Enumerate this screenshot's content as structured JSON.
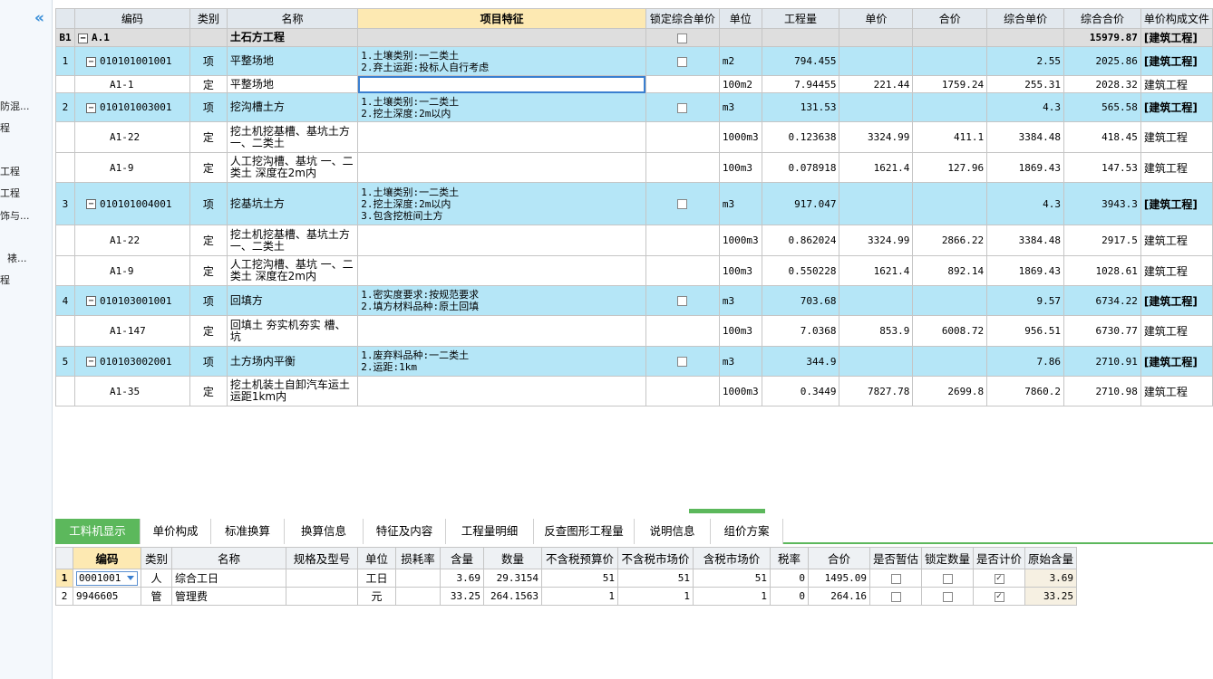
{
  "left_panel": {
    "collapse_icon": "double-chevron-left-icon",
    "items": [
      "防混...",
      "程",
      "工程",
      "工程",
      "饰与...",
      "裱...",
      "程"
    ]
  },
  "top_grid": {
    "headers": [
      "",
      "编码",
      "类别",
      "名称",
      "项目特征",
      "锁定综合单价",
      "单位",
      "工程量",
      "单价",
      "合价",
      "综合单价",
      "综合合价",
      "单价构成文件"
    ],
    "rows": [
      {
        "type": "b1",
        "seq": "B1",
        "code": "A.1",
        "cat": "",
        "name": "土石方工程",
        "feature": "",
        "lock": true,
        "unit": "",
        "qty": "",
        "price": "",
        "total": "",
        "comp_price": "",
        "comp_total": "15979.87",
        "file": "[建筑工程]"
      },
      {
        "type": "xiang",
        "seq": "1",
        "code": "010101001001",
        "cat": "项",
        "name": "平整场地",
        "feature": "1.土壤类别:一二类土\n2.弃土运距:投标人自行考虑",
        "lock": true,
        "unit": "m2",
        "qty": "794.455",
        "price": "",
        "total": "",
        "comp_price": "2.55",
        "comp_total": "2025.86",
        "file": "[建筑工程]"
      },
      {
        "type": "ding",
        "seq": "",
        "code": "A1-1",
        "cat": "定",
        "name": "平整场地",
        "feature": "",
        "lock": false,
        "unit": "100m2",
        "qty": "7.94455",
        "price": "221.44",
        "total": "1759.24",
        "comp_price": "255.31",
        "comp_total": "2028.32",
        "file": "建筑工程"
      },
      {
        "type": "xiang",
        "seq": "2",
        "code": "010101003001",
        "cat": "项",
        "name": "挖沟槽土方",
        "feature": "1.土壤类别:一二类土\n2.挖土深度:2m以内",
        "lock": true,
        "unit": "m3",
        "qty": "131.53",
        "price": "",
        "total": "",
        "comp_price": "4.3",
        "comp_total": "565.58",
        "file": "[建筑工程]"
      },
      {
        "type": "ding",
        "seq": "",
        "code": "A1-22",
        "cat": "定",
        "name": "挖土机挖基槽、基坑土方 一、二类土",
        "feature": "",
        "lock": false,
        "unit": "1000m3",
        "qty": "0.123638",
        "price": "3324.99",
        "total": "411.1",
        "comp_price": "3384.48",
        "comp_total": "418.45",
        "file": "建筑工程"
      },
      {
        "type": "ding",
        "seq": "",
        "code": "A1-9",
        "cat": "定",
        "name": "人工挖沟槽、基坑 一、二类土 深度在2m内",
        "feature": "",
        "lock": false,
        "unit": "100m3",
        "qty": "0.078918",
        "price": "1621.4",
        "total": "127.96",
        "comp_price": "1869.43",
        "comp_total": "147.53",
        "file": "建筑工程"
      },
      {
        "type": "xiang",
        "seq": "3",
        "code": "010101004001",
        "cat": "项",
        "name": "挖基坑土方",
        "feature": "1.土壤类别:一二类土\n2.挖土深度:2m以内\n3.包含挖桩间土方",
        "lock": true,
        "unit": "m3",
        "qty": "917.047",
        "price": "",
        "total": "",
        "comp_price": "4.3",
        "comp_total": "3943.3",
        "file": "[建筑工程]"
      },
      {
        "type": "ding",
        "seq": "",
        "code": "A1-22",
        "cat": "定",
        "name": "挖土机挖基槽、基坑土方 一、二类土",
        "feature": "",
        "lock": false,
        "unit": "1000m3",
        "qty": "0.862024",
        "price": "3324.99",
        "total": "2866.22",
        "comp_price": "3384.48",
        "comp_total": "2917.5",
        "file": "建筑工程"
      },
      {
        "type": "ding",
        "seq": "",
        "code": "A1-9",
        "cat": "定",
        "name": "人工挖沟槽、基坑 一、二类土 深度在2m内",
        "feature": "",
        "lock": false,
        "unit": "100m3",
        "qty": "0.550228",
        "price": "1621.4",
        "total": "892.14",
        "comp_price": "1869.43",
        "comp_total": "1028.61",
        "file": "建筑工程"
      },
      {
        "type": "xiang",
        "seq": "4",
        "code": "010103001001",
        "cat": "项",
        "name": "回填方",
        "feature": "1.密实度要求:按规范要求\n2.填方材料品种:原土回填",
        "lock": true,
        "unit": "m3",
        "qty": "703.68",
        "price": "",
        "total": "",
        "comp_price": "9.57",
        "comp_total": "6734.22",
        "file": "[建筑工程]"
      },
      {
        "type": "ding",
        "seq": "",
        "code": "A1-147",
        "cat": "定",
        "name": "回填土 夯实机夯实 槽、坑",
        "feature": "",
        "lock": false,
        "unit": "100m3",
        "qty": "7.0368",
        "price": "853.9",
        "total": "6008.72",
        "comp_price": "956.51",
        "comp_total": "6730.77",
        "file": "建筑工程"
      },
      {
        "type": "xiang",
        "seq": "5",
        "code": "010103002001",
        "cat": "项",
        "name": "土方场内平衡",
        "feature": "1.废弃料品种:一二类土\n2.运距:1km",
        "lock": true,
        "unit": "m3",
        "qty": "344.9",
        "price": "",
        "total": "",
        "comp_price": "7.86",
        "comp_total": "2710.91",
        "file": "[建筑工程]"
      },
      {
        "type": "ding",
        "seq": "",
        "code": "A1-35",
        "cat": "定",
        "name": "挖土机装土自卸汽车运土 运距1km内",
        "feature": "",
        "lock": false,
        "unit": "1000m3",
        "qty": "0.3449",
        "price": "7827.78",
        "total": "2699.8",
        "comp_price": "7860.2",
        "comp_total": "2710.98",
        "file": "建筑工程"
      }
    ]
  },
  "tabs": [
    "工料机显示",
    "单价构成",
    "标准换算",
    "换算信息",
    "特征及内容",
    "工程量明细",
    "反查图形工程量",
    "说明信息",
    "组价方案"
  ],
  "active_tab": "工料机显示",
  "bottom_grid": {
    "headers": [
      "",
      "编码",
      "类别",
      "名称",
      "规格及型号",
      "单位",
      "损耗率",
      "含量",
      "数量",
      "不含税预算价",
      "不含税市场价",
      "含税市场价",
      "税率",
      "合价",
      "是否暂估",
      "锁定数量",
      "是否计价",
      "原始含量"
    ],
    "rows": [
      {
        "seq": "1",
        "code": "0001001",
        "cat": "人",
        "name": "综合工日",
        "spec": "",
        "unit": "工日",
        "loss": "",
        "content": "3.69",
        "qty": "29.3154",
        "budget": "51",
        "market": "51",
        "tax_market": "51",
        "tax_rate": "0",
        "total": "1495.09",
        "est": false,
        "lock": false,
        "priced": true,
        "orig": "3.69"
      },
      {
        "seq": "2",
        "code": "9946605",
        "cat": "管",
        "name": "管理费",
        "spec": "",
        "unit": "元",
        "loss": "",
        "content": "33.25",
        "qty": "264.1563",
        "budget": "1",
        "market": "1",
        "tax_market": "1",
        "tax_rate": "0",
        "total": "264.16",
        "est": false,
        "lock": false,
        "priced": true,
        "orig": "33.25"
      }
    ]
  }
}
